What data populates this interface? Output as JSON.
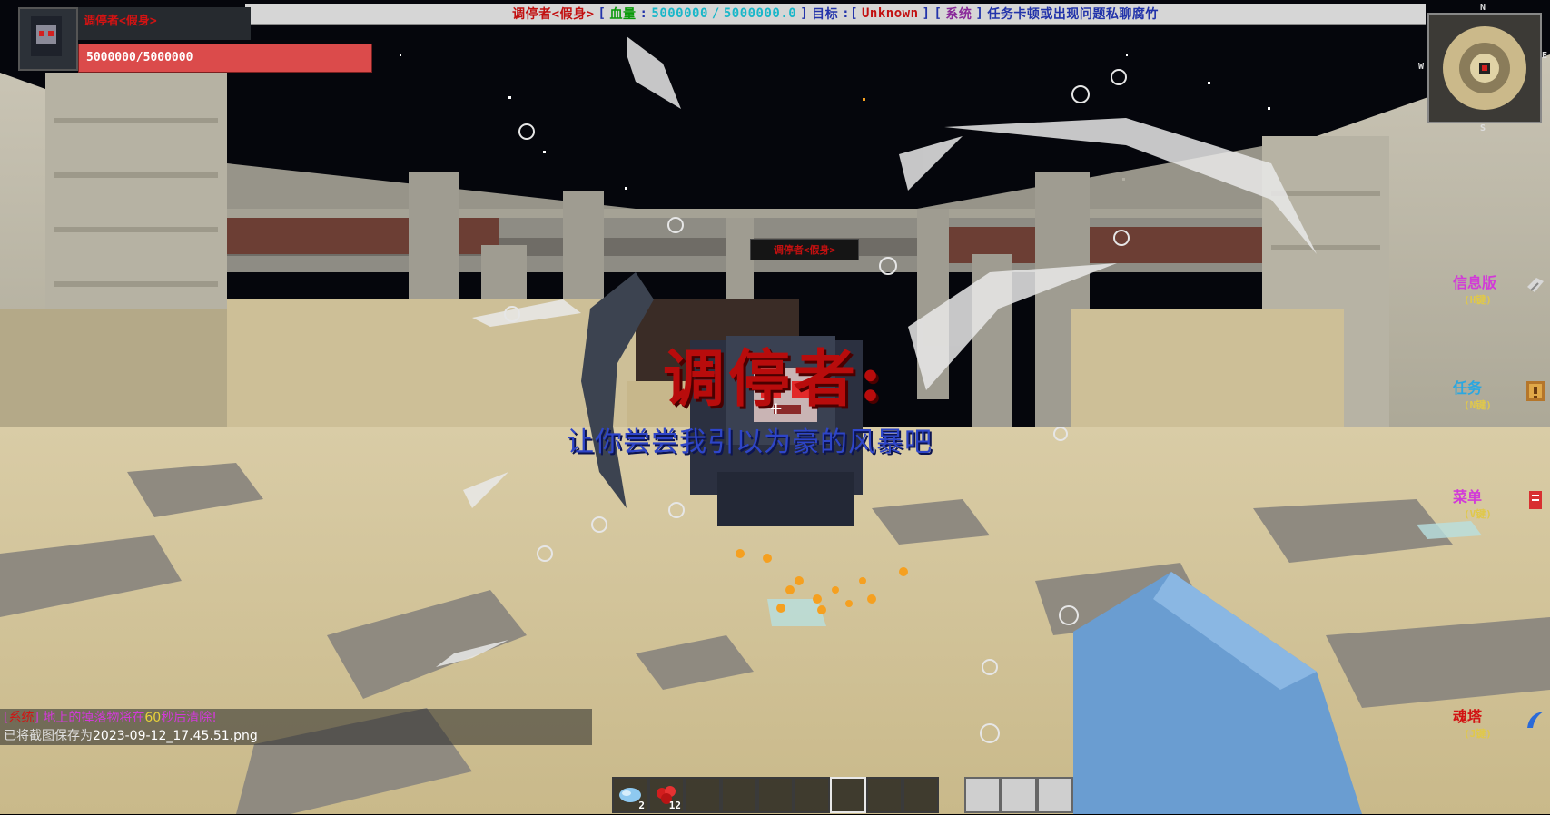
{
  "banner": {
    "boss_name": "调停者<假身>",
    "hp_label": "血量",
    "hp_current": "5000000",
    "hp_separator": "/",
    "hp_max": "5000000.0",
    "target_label": "目标",
    "target_value": "Unknown",
    "system_tag": "系统",
    "system_message": "任务卡顿或出现问题私聊腐竹"
  },
  "boss_panel": {
    "name": "调停者<假身>",
    "hp_text": "5000000/5000000",
    "hp_fraction": 1.0
  },
  "boss_nameplate": "调停者<假身>",
  "dialog": {
    "speaker": "调停者:",
    "line": "让你尝尝我引以为豪的风暴吧"
  },
  "minimap": {
    "north": "N",
    "south": "S",
    "east": "E",
    "west": "W"
  },
  "side_menu": [
    {
      "label": "信息版",
      "key": "(H键)",
      "color": "#d23ad8",
      "icon": "info-board-icon"
    },
    {
      "label": "任务",
      "key": "(N键)",
      "color": "#2aa7e0",
      "icon": "quest-book-icon"
    },
    {
      "label": "菜单",
      "key": "(V键)",
      "color": "#d23ad8",
      "icon": "menu-card-icon"
    },
    {
      "label": "魂塔",
      "key": "(J键)",
      "color": "#d21313",
      "icon": "soul-tower-icon"
    }
  ],
  "chat": {
    "line1_tag": "系统",
    "line1_pre": "地上的掉落物将在",
    "line1_num": "60",
    "line1_post": "秒后清除!",
    "line2_pre": "已将截图保存为",
    "line2_file": "2023-09-12_17.45.51.png"
  },
  "hotbar": {
    "slots": [
      {
        "item": "blue-crystal-icon",
        "count": "2"
      },
      {
        "item": "red-gem-icon",
        "count": "12"
      },
      {
        "item": "",
        "count": ""
      },
      {
        "item": "",
        "count": ""
      },
      {
        "item": "",
        "count": ""
      },
      {
        "item": "",
        "count": ""
      },
      {
        "item": "",
        "count": ""
      },
      {
        "item": "",
        "count": ""
      },
      {
        "item": "",
        "count": ""
      }
    ],
    "selected_index": 6
  },
  "colors": {
    "boss_red": "#c21010",
    "hp_bar": "#db4b4b",
    "dialog_blue": "#2e45c8",
    "sky": "#05060c",
    "sand": "#d8c89a"
  }
}
